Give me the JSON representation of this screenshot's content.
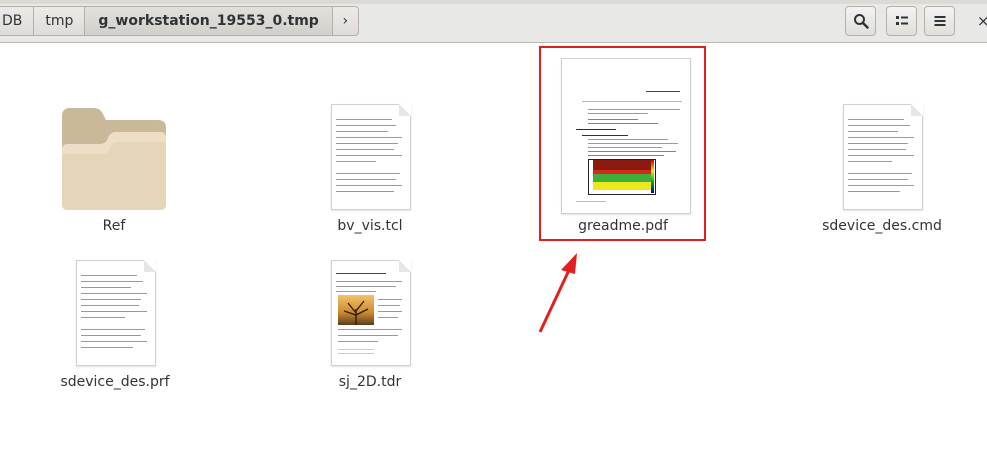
{
  "breadcrumb": {
    "items": [
      {
        "label": "DB"
      },
      {
        "label": "tmp"
      },
      {
        "label": "g_workstation_19553_0.tmp"
      }
    ],
    "next_glyph": "›"
  },
  "toolbar": {
    "search_icon": "search-icon",
    "view_icon": "list-view-icon",
    "menu_icon": "hamburger-menu-icon",
    "close_glyph": "×"
  },
  "files": [
    {
      "name": "Ref",
      "icon": "folder-icon"
    },
    {
      "name": "bv_vis.tcl",
      "icon": "text-document-icon"
    },
    {
      "name": "greadme.pdf",
      "icon": "pdf-thumbnail-icon"
    },
    {
      "name": "sdevice_des.cmd",
      "icon": "text-document-icon"
    },
    {
      "name": "sdevice_des.prf",
      "icon": "text-document-icon"
    },
    {
      "name": "sj_2D.tdr",
      "icon": "image-document-icon"
    }
  ],
  "annotation": {
    "highlight_color": "#e0201f",
    "highlighted_file": "greadme.pdf"
  }
}
